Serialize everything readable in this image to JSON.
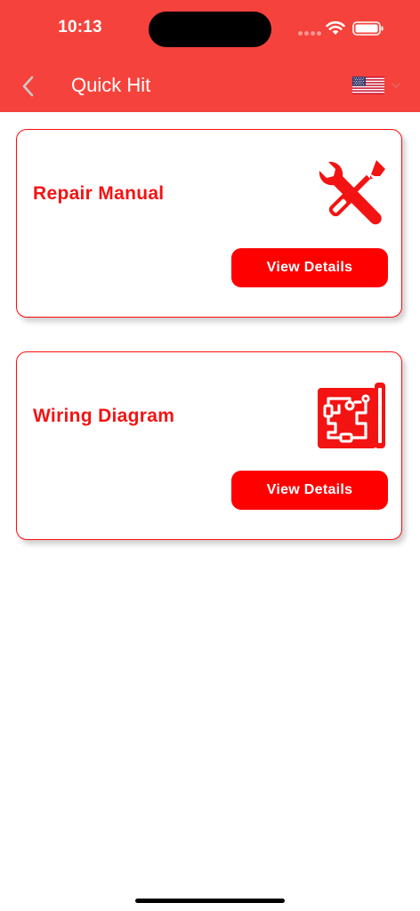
{
  "status_bar": {
    "time": "10:13"
  },
  "nav": {
    "title": "Quick Hit",
    "back_icon": "chevron-left-icon",
    "language_flag": "us-flag-icon"
  },
  "cards": [
    {
      "title": "Repair Manual",
      "icon": "wrench-screwdriver-icon",
      "button_label": "View Details"
    },
    {
      "title": "Wiring Diagram",
      "icon": "wiring-diagram-icon",
      "button_label": "View Details"
    }
  ],
  "colors": {
    "header": "#f6423c",
    "accent": "#fe0000",
    "title_text": "#f31313",
    "card_border": "#ff0b0b"
  }
}
